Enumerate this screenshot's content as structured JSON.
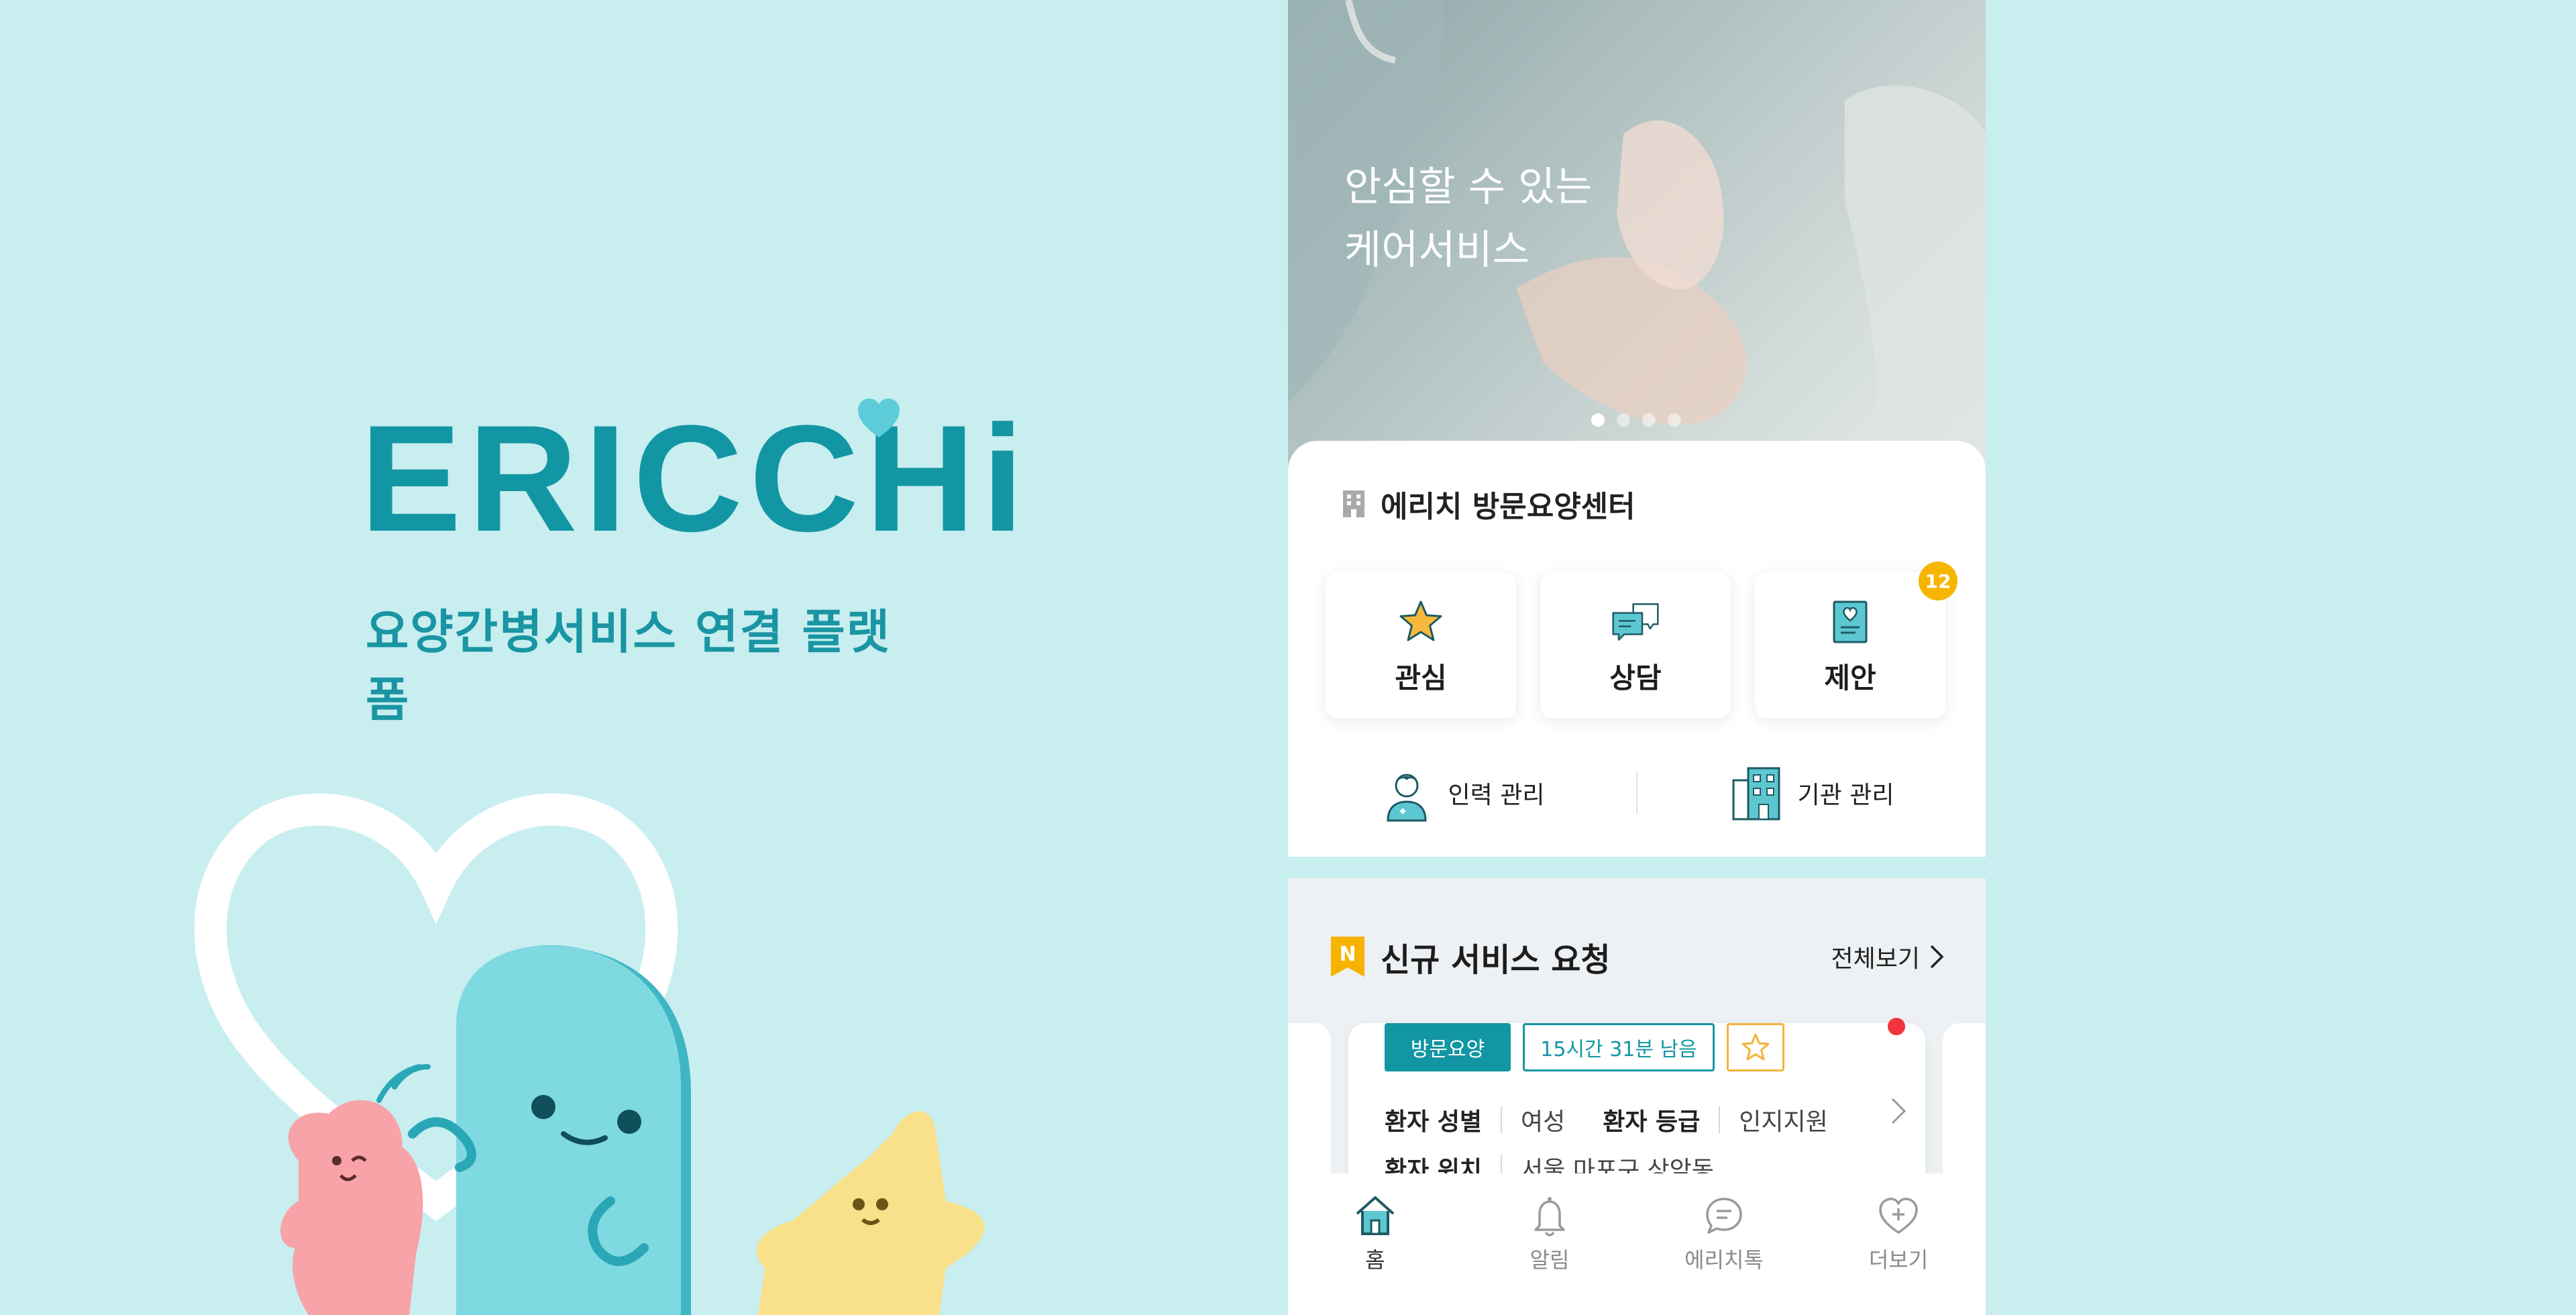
{
  "brand": {
    "logo_text": "ERICCHi",
    "tagline": "요양간병서비스 연결 플랫폼",
    "colors": {
      "primary": "#1396a4",
      "background": "#c8eef0",
      "accent_yellow": "#f7b500",
      "alert_red": "#f2343d"
    }
  },
  "hero": {
    "title_line1": "안심할 수 있는",
    "title_line2": "케어서비스",
    "pagination": {
      "total": 4,
      "active_index": 1
    }
  },
  "center": {
    "name": "에리치 방문요양센터",
    "icon": "building-icon"
  },
  "tiles": [
    {
      "label": "관심",
      "icon": "star-icon"
    },
    {
      "label": "상담",
      "icon": "chat-icon"
    },
    {
      "label": "제안",
      "icon": "document-heart-icon",
      "badge": "12"
    }
  ],
  "management": [
    {
      "label": "인력 관리",
      "icon": "caregiver-icon"
    },
    {
      "label": "기관 관리",
      "icon": "hospital-icon"
    }
  ],
  "new_requests": {
    "badge_letter": "N",
    "title": "신규 서비스 요청",
    "view_all": "전체보기",
    "card": {
      "service_type": "방문요양",
      "time_left": "15시간 31분 남음",
      "favorite": false,
      "unread": true,
      "fields": {
        "gender_label": "환자 성별",
        "gender_value": "여성",
        "grade_label": "환자 등급",
        "grade_value": "인지지원",
        "location_label": "환자 위치",
        "location_value": "서울 마포구 상암동"
      }
    }
  },
  "tabbar": [
    {
      "label": "홈",
      "icon": "home-icon",
      "active": true
    },
    {
      "label": "알림",
      "icon": "bell-icon",
      "active": false
    },
    {
      "label": "에리치톡",
      "icon": "message-icon",
      "active": false
    },
    {
      "label": "더보기",
      "icon": "heart-plus-icon",
      "active": false
    }
  ]
}
